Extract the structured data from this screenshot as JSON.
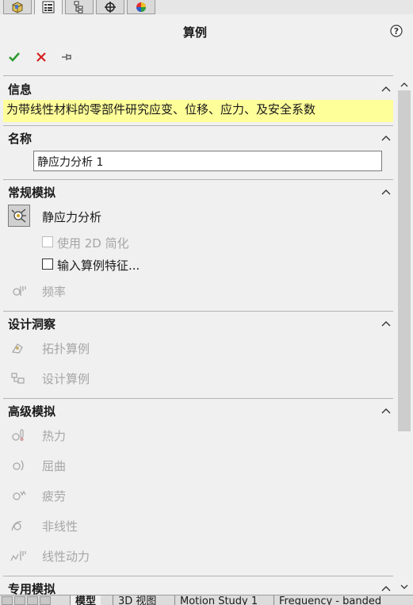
{
  "top_tabs": [
    "featuremanager-icon",
    "propertymanager-icon",
    "configurationmanager-icon",
    "dimxpert-icon",
    "displaymanager-icon"
  ],
  "panel": {
    "title": "算例"
  },
  "sections": {
    "info": {
      "header": "信息",
      "text": "为带线性材料的零部件研究应变、位移、应力、及安全系数"
    },
    "name": {
      "header": "名称",
      "value": "静应力分析 1"
    },
    "general": {
      "header": "常规模拟",
      "static": "静应力分析",
      "use_2d": "使用 2D 简化",
      "input_features": "输入算例特征...",
      "frequency": "频率"
    },
    "design": {
      "header": "设计洞察",
      "topology": "拓扑算例",
      "design_study": "设计算例"
    },
    "advanced": {
      "header": "高级模拟",
      "thermal": "热力",
      "buckling": "屈曲",
      "fatigue": "疲劳",
      "nonlinear": "非线性",
      "linear_dynamic": "线性动力"
    },
    "special": {
      "header": "专用模拟"
    }
  },
  "bottom_tabs": [
    "模型",
    "3D 视图",
    "Motion Study 1",
    "Frequency - banded"
  ],
  "colors": {
    "ok": "#2e9b2e",
    "cancel": "#d42020",
    "info_bg": "#ffff99"
  }
}
